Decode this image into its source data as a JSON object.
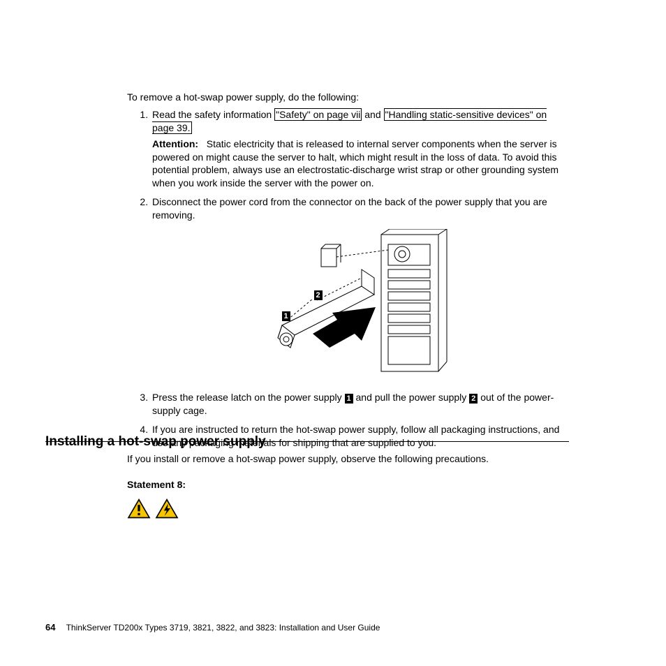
{
  "content": {
    "intro": "To remove a hot-swap power supply, do the following:",
    "items": {
      "0": {
        "pre": "Read the safety information ",
        "link1": "\"Safety\" on page vii",
        "mid": " and ",
        "link2": "\"Handling static-sensitive devices\" on page 39.",
        "attn_label": "Attention:",
        "attn_body": "Static electricity that is released to internal server components when the server is powered on might cause the server to halt, which might result in the loss of data. To avoid this potential problem, always use an electrostatic-discharge wrist strap or other grounding system when you work inside the server with the power on."
      },
      "1": {
        "text": "Disconnect the power cord from the connector on the back of the power supply that you are removing."
      },
      "2": {
        "pre": "Press the release latch on the power supply ",
        "c1": "1",
        "mid": " and pull the power supply ",
        "c2": "2",
        "post": " out of the power-supply cage."
      },
      "3": {
        "text": "If you are instructed to return the hot-swap power supply, follow all packaging instructions, and use any packaging materials for shipping that are supplied to you."
      }
    }
  },
  "figure": {
    "callouts": {
      "c1": "1",
      "c2": "2"
    }
  },
  "section": {
    "heading": "Installing a hot-swap power supply",
    "intro": "If you install or remove a hot-swap power supply, observe the following precautions.",
    "statement": "Statement 8:"
  },
  "footer": {
    "page": "64",
    "title": "ThinkServer TD200x Types 3719, 3821, 3822, and 3823: Installation and User Guide"
  }
}
